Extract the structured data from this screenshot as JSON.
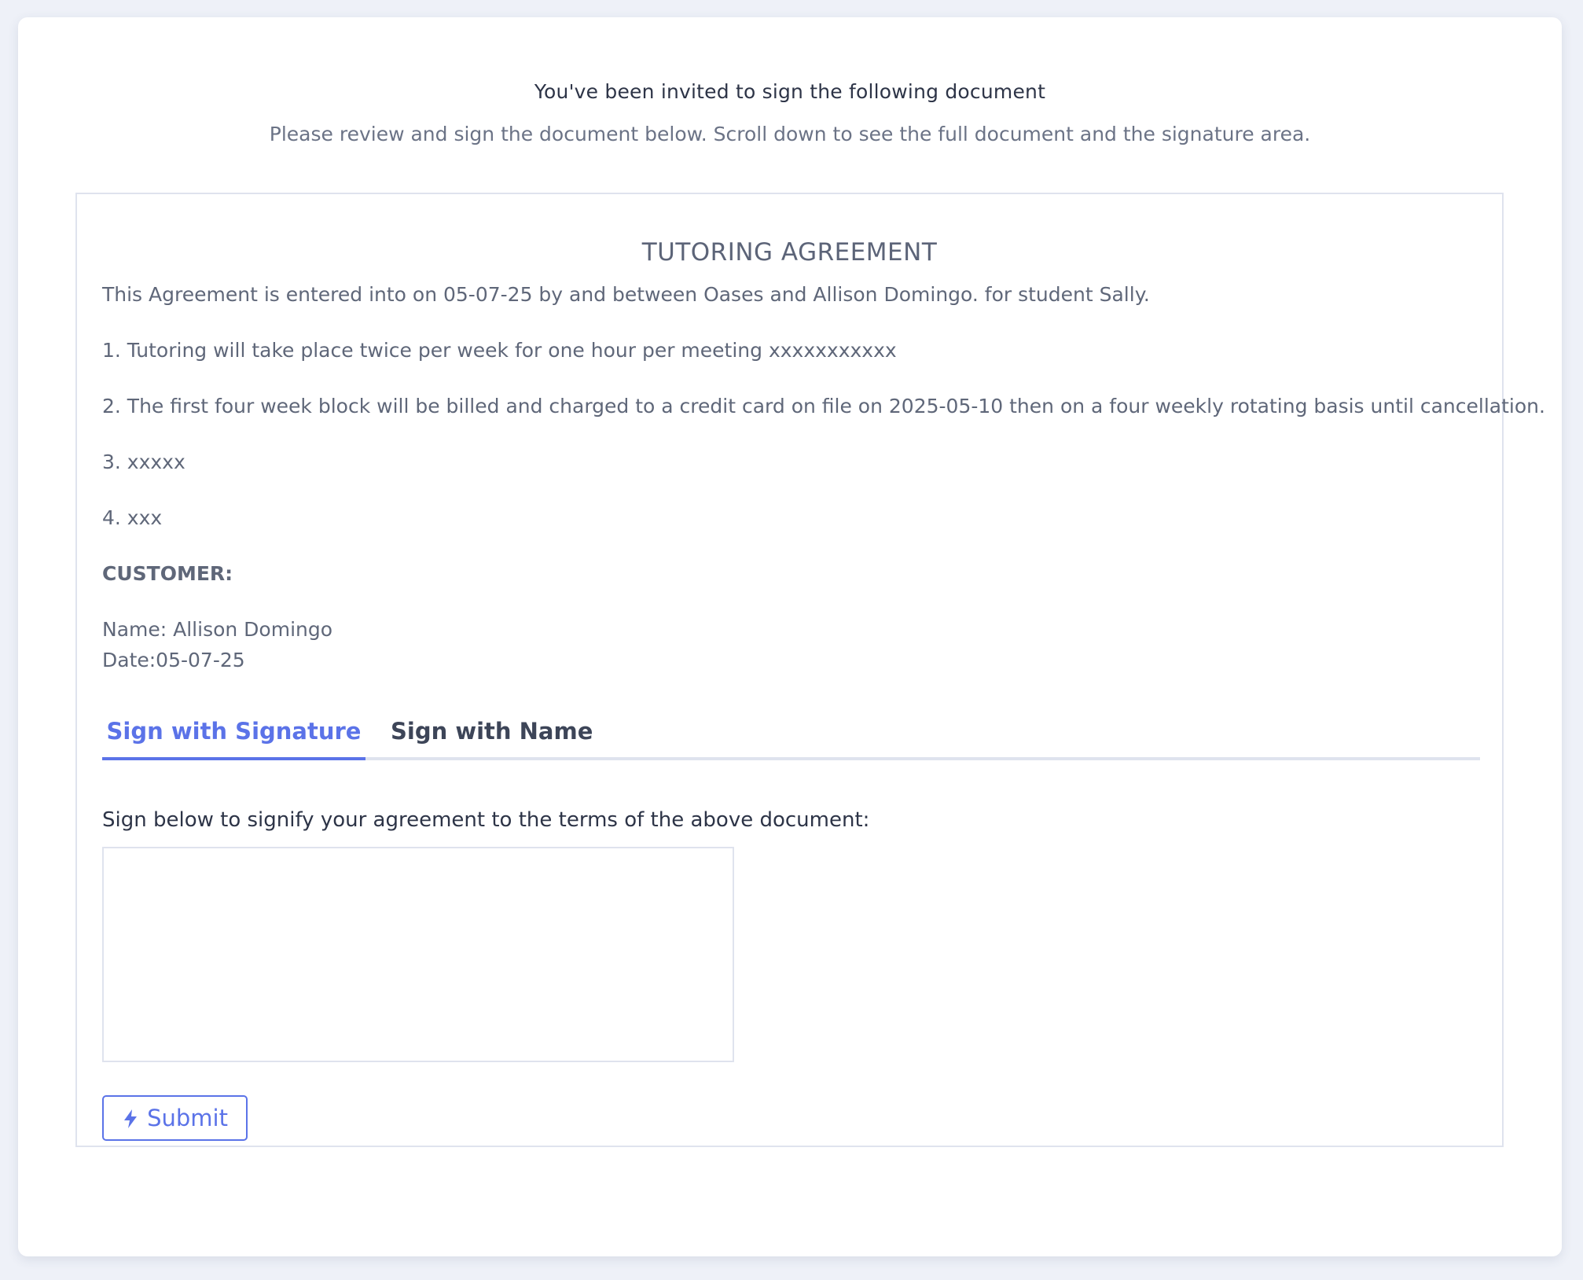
{
  "header": {
    "title": "You've been invited to sign the following document",
    "subtitle": "Please review and sign the document below. Scroll down to see the full document and the signature area."
  },
  "document": {
    "heading": "TUTORING AGREEMENT",
    "intro": "This Agreement is entered into on 05-07-25 by and between Oases and Allison Domingo. for student Sally.",
    "items": [
      "1. Tutoring will take place twice per week for one hour per meeting xxxxxxxxxxx",
      "2. The first four week block will be billed and charged to a credit card on file on 2025-05-10 then on a four weekly rotating basis until cancellation.",
      "3. xxxxx",
      "4. xxx"
    ],
    "customer_label": "CUSTOMER:",
    "customer_name": "Name: Allison Domingo",
    "customer_date": "Date:05-07-25"
  },
  "signing": {
    "tabs": [
      {
        "label": "Sign with Signature",
        "active": true
      },
      {
        "label": "Sign with Name",
        "active": false
      }
    ],
    "instructions": "Sign below to signify your agreement to the terms of the above document:",
    "submit_label": "Submit",
    "submit_icon": "bolt-icon"
  },
  "colors": {
    "accent": "#5b73e8",
    "background": "#eef1f8",
    "text_dark": "#2d3447",
    "text_muted": "#5f6779",
    "border": "#dfe3ee"
  }
}
